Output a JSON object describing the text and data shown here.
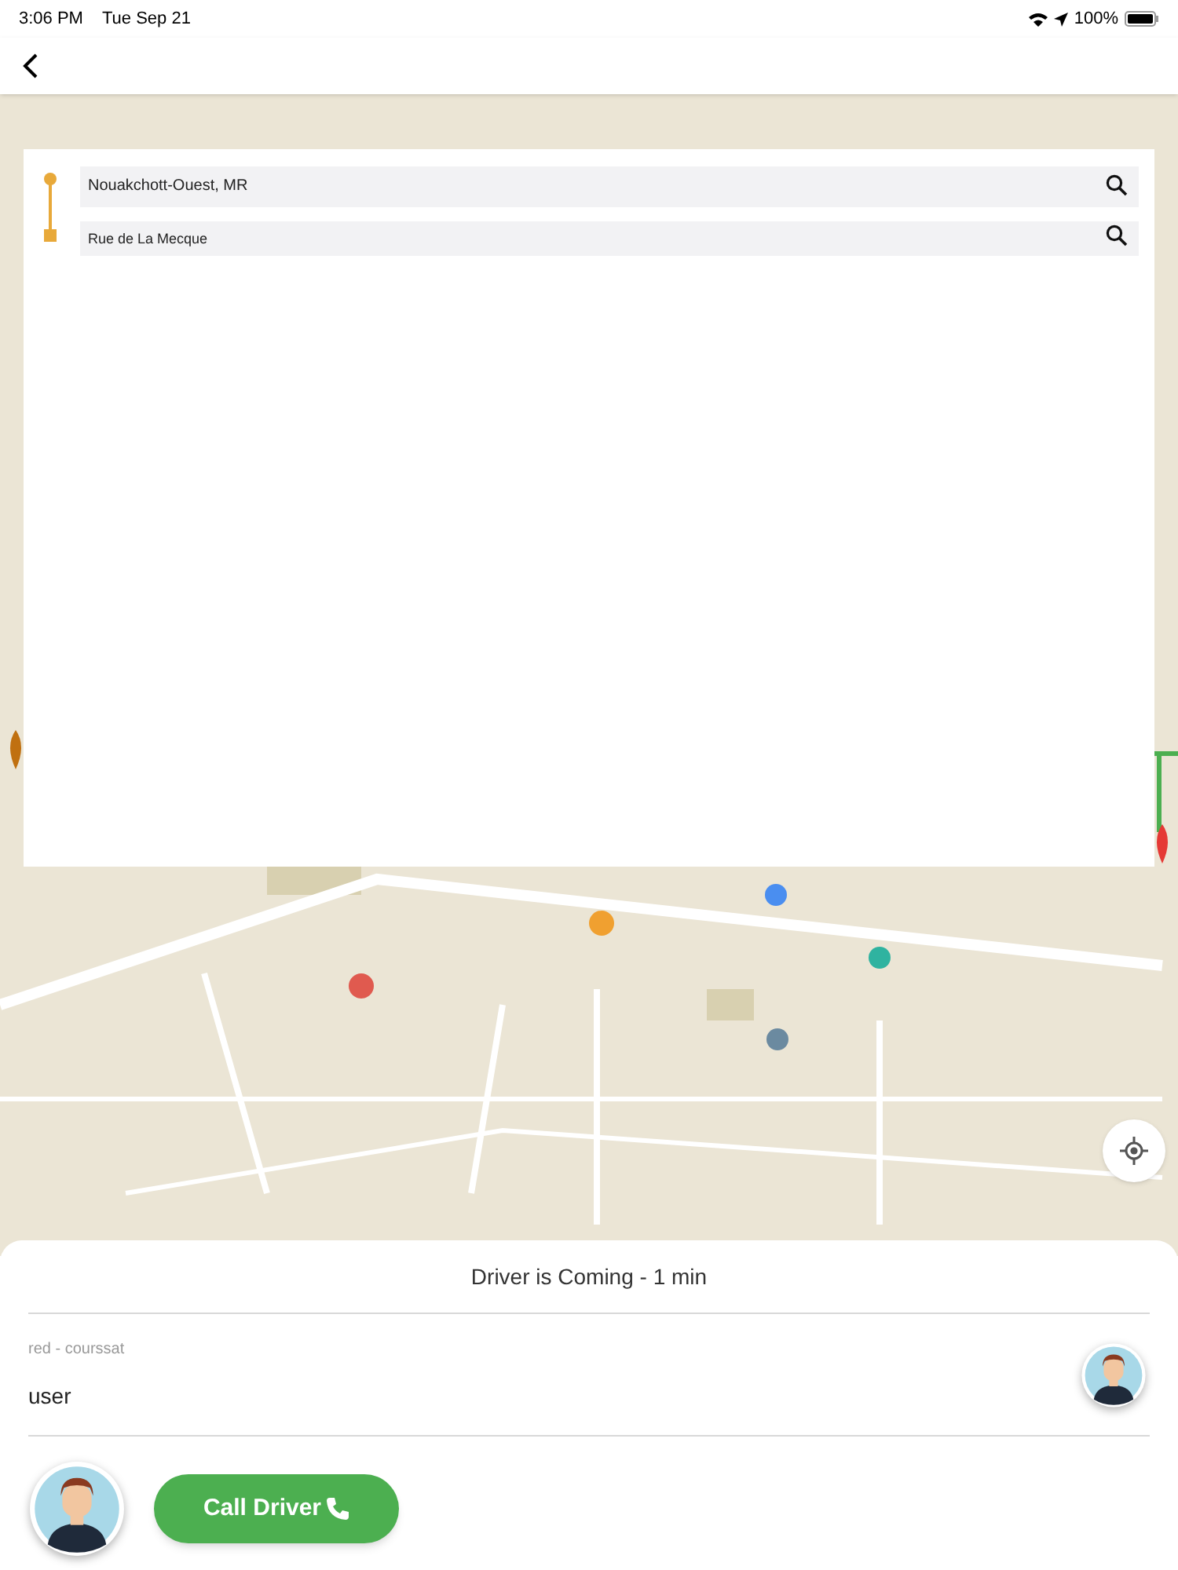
{
  "status_bar": {
    "time": "3:06 PM",
    "date": "Tue Sep 21",
    "battery": "100%"
  },
  "route": {
    "from": "Nouakchott-Ouest, MR",
    "to": "Rue de La Mecque"
  },
  "sheet": {
    "title": "Driver is Coming - 1 min",
    "subtitle": "red - courssat",
    "name": "user",
    "call_button": "Call Driver"
  }
}
